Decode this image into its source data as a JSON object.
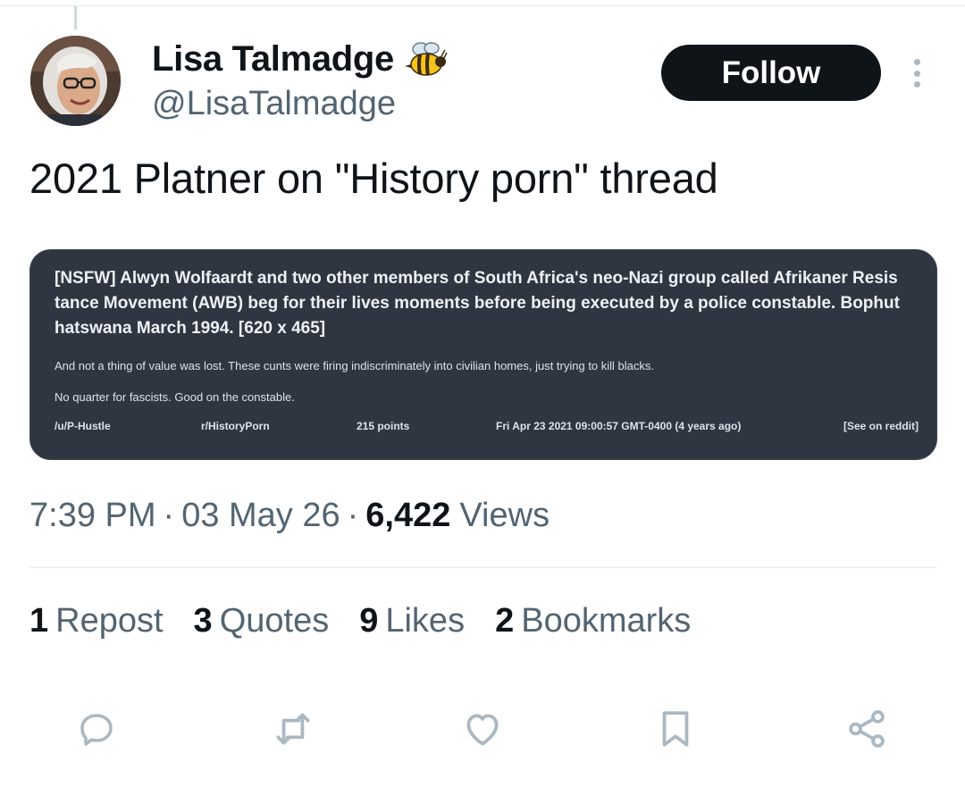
{
  "user": {
    "display_name": "Lisa Talmadge",
    "handle": "@LisaTalmadge",
    "emoji_icon": "bee-emoji"
  },
  "header": {
    "follow_label": "Follow",
    "more_icon": "more-vertical-icon"
  },
  "tweet": {
    "text": "2021 Platner on \"History porn\" thread"
  },
  "embedded_card": {
    "title": "[NSFW] Alwyn Wolfaardt and two other members of South Africa's neo-Nazi group called Afrikaner Resis tance Movement (AWB) beg for their lives moments before being executed by a police constable. Bophut hatswana March 1994. [620 x 465]",
    "body_line_1": "And not a thing of value was lost. These cunts were firing indiscriminately into civilian homes, just trying to kill blacks.",
    "body_line_2": "No quarter for fascists. Good on the constable.",
    "footer": {
      "user": "/u/P-Hustle",
      "subreddit": "r/HistoryPorn",
      "points": "215 points",
      "date": "Fri Apr 23 2021 09:00:57 GMT-0400 (4 years ago)",
      "link": "[See on reddit]"
    },
    "background_color": "#2f3642"
  },
  "meta": {
    "time": "7:39 PM",
    "date": "03 May 26",
    "views_count": "6,422",
    "views_label": "Views",
    "separator": "·"
  },
  "stats": {
    "reposts_count": "1",
    "reposts_label": "Repost",
    "quotes_count": "3",
    "quotes_label": "Quotes",
    "likes_count": "9",
    "likes_label": "Likes",
    "bookmarks_count": "2",
    "bookmarks_label": "Bookmarks"
  },
  "actions": [
    "reply-icon",
    "repost-icon",
    "like-icon",
    "bookmark-icon",
    "share-icon"
  ],
  "colors": {
    "text_primary": "#0f1419",
    "text_secondary": "#536471",
    "icon_gray": "#aab8c2",
    "follow_bg": "#0f1419"
  }
}
